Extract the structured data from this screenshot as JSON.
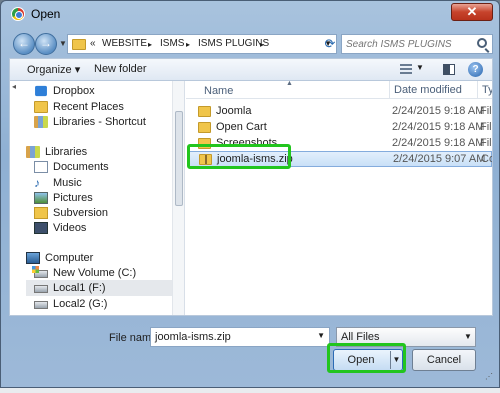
{
  "window": {
    "title": "Open",
    "close_glyph": "✕"
  },
  "address": {
    "breadcrumbs": [
      "«",
      "WEBSITE",
      "▸",
      "ISMS",
      "▸",
      "ISMS PLUGINS",
      "▸"
    ],
    "refresh_glyph": "⟳"
  },
  "search": {
    "placeholder": "Search ISMS PLUGINS"
  },
  "toolbar": {
    "organize_label": "Organize ▾",
    "new_folder_label": "New folder",
    "help_glyph": "?"
  },
  "nav": {
    "favorites": [
      {
        "label": "Dropbox",
        "icon": "dropbox-icon"
      },
      {
        "label": "Recent Places",
        "icon": "recent-places-icon"
      },
      {
        "label": "Libraries - Shortcut",
        "icon": "library-icon"
      }
    ],
    "libraries": {
      "label": "Libraries",
      "items": [
        {
          "label": "Documents",
          "icon": "documents-icon"
        },
        {
          "label": "Music",
          "icon": "music-icon"
        },
        {
          "label": "Pictures",
          "icon": "pictures-icon"
        },
        {
          "label": "Subversion",
          "icon": "folder-icon"
        },
        {
          "label": "Videos",
          "icon": "videos-icon"
        }
      ]
    },
    "computer": {
      "label": "Computer",
      "items": [
        {
          "label": "New Volume (C:)",
          "icon": "windows-drive-icon"
        },
        {
          "label": "Local1 (F:)",
          "icon": "drive-icon",
          "selected": true
        },
        {
          "label": "Local2 (G:)",
          "icon": "drive-icon"
        }
      ]
    }
  },
  "files": {
    "columns": {
      "name": "Name",
      "date": "Date modified",
      "type": "Ty"
    },
    "rows": [
      {
        "name": "Joomla",
        "date": "2/24/2015 9:18 AM",
        "type": "File",
        "icon": "folder-icon"
      },
      {
        "name": "Open Cart",
        "date": "2/24/2015 9:18 AM",
        "type": "File",
        "icon": "folder-icon"
      },
      {
        "name": "Screenshots",
        "date": "2/24/2015 9:18 AM",
        "type": "File",
        "icon": "folder-icon"
      },
      {
        "name": "joomla-isms.zip",
        "date": "2/24/2015 9:07 AM",
        "type": "Co",
        "icon": "zip-folder-icon",
        "selected": true
      }
    ]
  },
  "form": {
    "file_name_label": "File name:",
    "file_name_value": "joomla-isms.zip",
    "file_type_value": "All Files",
    "open_label": "Open",
    "cancel_label": "Cancel"
  },
  "colors": {
    "highlight": "#22c51e",
    "selection": "#c9e0f7"
  }
}
